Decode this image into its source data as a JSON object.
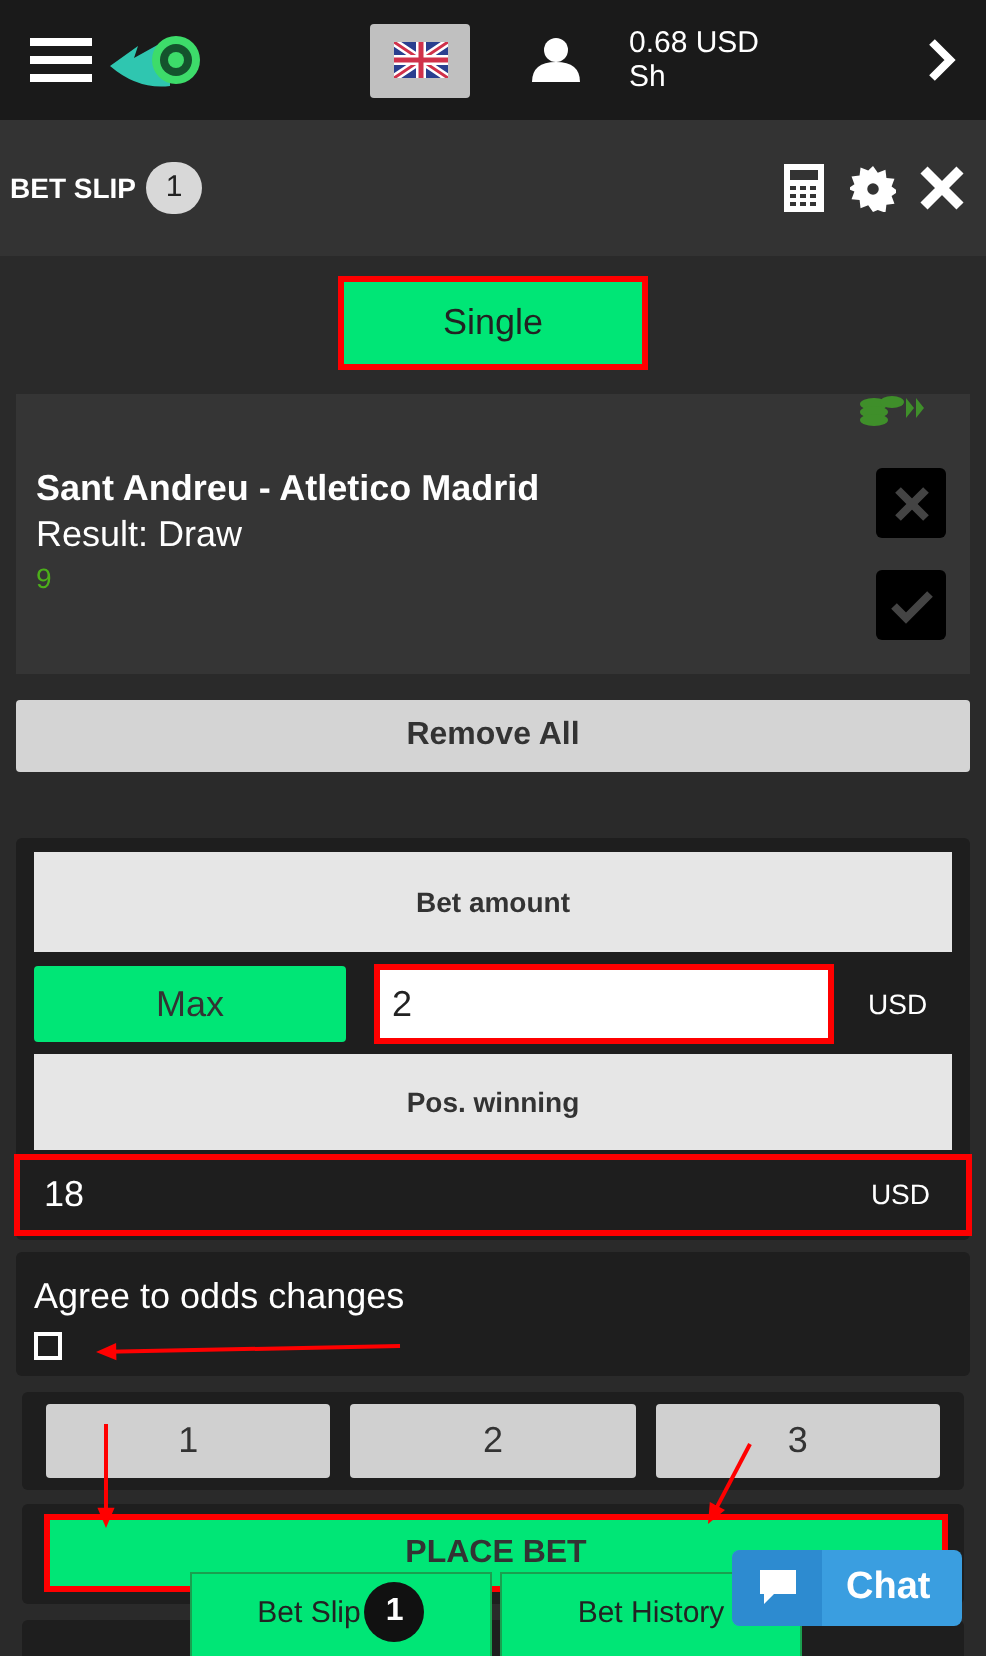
{
  "header": {
    "balance": "0.68 USD",
    "account": "Sh"
  },
  "bet_slip": {
    "title": "BET SLIP",
    "count": "1"
  },
  "bet_types": [
    {
      "label": "Single",
      "selected": true,
      "highlighted": true
    }
  ],
  "bet": {
    "match": "Sant Andreu - Atletico Madrid",
    "result": "Result: Draw",
    "odds": "9"
  },
  "remove_all": "Remove All",
  "stake": {
    "amount_label": "Bet amount",
    "max": "Max",
    "amount": "2",
    "currency": "USD",
    "amount_highlighted": true,
    "winning_label": "Pos. winning",
    "winning": "18",
    "winning_currency": "USD",
    "winning_highlighted": true
  },
  "agree": {
    "label": "Agree to odds changes",
    "checked": false
  },
  "quick_stakes": [
    "1",
    "2",
    "3"
  ],
  "place_bet": {
    "label": "PLACE BET",
    "highlighted": true
  },
  "bottom_tabs": [
    {
      "label": "Bet Slip",
      "badge": "1"
    },
    {
      "label": "Bet History"
    }
  ],
  "chat": "Chat"
}
